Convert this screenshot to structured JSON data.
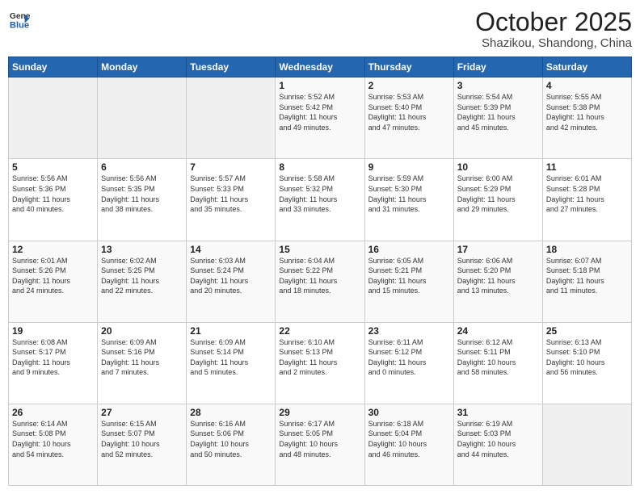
{
  "logo": {
    "general": "General",
    "blue": "Blue"
  },
  "title": "October 2025",
  "location": "Shazikou, Shandong, China",
  "days_header": [
    "Sunday",
    "Monday",
    "Tuesday",
    "Wednesday",
    "Thursday",
    "Friday",
    "Saturday"
  ],
  "weeks": [
    [
      {
        "day": "",
        "info": ""
      },
      {
        "day": "",
        "info": ""
      },
      {
        "day": "",
        "info": ""
      },
      {
        "day": "1",
        "info": "Sunrise: 5:52 AM\nSunset: 5:42 PM\nDaylight: 11 hours\nand 49 minutes."
      },
      {
        "day": "2",
        "info": "Sunrise: 5:53 AM\nSunset: 5:40 PM\nDaylight: 11 hours\nand 47 minutes."
      },
      {
        "day": "3",
        "info": "Sunrise: 5:54 AM\nSunset: 5:39 PM\nDaylight: 11 hours\nand 45 minutes."
      },
      {
        "day": "4",
        "info": "Sunrise: 5:55 AM\nSunset: 5:38 PM\nDaylight: 11 hours\nand 42 minutes."
      }
    ],
    [
      {
        "day": "5",
        "info": "Sunrise: 5:56 AM\nSunset: 5:36 PM\nDaylight: 11 hours\nand 40 minutes."
      },
      {
        "day": "6",
        "info": "Sunrise: 5:56 AM\nSunset: 5:35 PM\nDaylight: 11 hours\nand 38 minutes."
      },
      {
        "day": "7",
        "info": "Sunrise: 5:57 AM\nSunset: 5:33 PM\nDaylight: 11 hours\nand 35 minutes."
      },
      {
        "day": "8",
        "info": "Sunrise: 5:58 AM\nSunset: 5:32 PM\nDaylight: 11 hours\nand 33 minutes."
      },
      {
        "day": "9",
        "info": "Sunrise: 5:59 AM\nSunset: 5:30 PM\nDaylight: 11 hours\nand 31 minutes."
      },
      {
        "day": "10",
        "info": "Sunrise: 6:00 AM\nSunset: 5:29 PM\nDaylight: 11 hours\nand 29 minutes."
      },
      {
        "day": "11",
        "info": "Sunrise: 6:01 AM\nSunset: 5:28 PM\nDaylight: 11 hours\nand 27 minutes."
      }
    ],
    [
      {
        "day": "12",
        "info": "Sunrise: 6:01 AM\nSunset: 5:26 PM\nDaylight: 11 hours\nand 24 minutes."
      },
      {
        "day": "13",
        "info": "Sunrise: 6:02 AM\nSunset: 5:25 PM\nDaylight: 11 hours\nand 22 minutes."
      },
      {
        "day": "14",
        "info": "Sunrise: 6:03 AM\nSunset: 5:24 PM\nDaylight: 11 hours\nand 20 minutes."
      },
      {
        "day": "15",
        "info": "Sunrise: 6:04 AM\nSunset: 5:22 PM\nDaylight: 11 hours\nand 18 minutes."
      },
      {
        "day": "16",
        "info": "Sunrise: 6:05 AM\nSunset: 5:21 PM\nDaylight: 11 hours\nand 15 minutes."
      },
      {
        "day": "17",
        "info": "Sunrise: 6:06 AM\nSunset: 5:20 PM\nDaylight: 11 hours\nand 13 minutes."
      },
      {
        "day": "18",
        "info": "Sunrise: 6:07 AM\nSunset: 5:18 PM\nDaylight: 11 hours\nand 11 minutes."
      }
    ],
    [
      {
        "day": "19",
        "info": "Sunrise: 6:08 AM\nSunset: 5:17 PM\nDaylight: 11 hours\nand 9 minutes."
      },
      {
        "day": "20",
        "info": "Sunrise: 6:09 AM\nSunset: 5:16 PM\nDaylight: 11 hours\nand 7 minutes."
      },
      {
        "day": "21",
        "info": "Sunrise: 6:09 AM\nSunset: 5:14 PM\nDaylight: 11 hours\nand 5 minutes."
      },
      {
        "day": "22",
        "info": "Sunrise: 6:10 AM\nSunset: 5:13 PM\nDaylight: 11 hours\nand 2 minutes."
      },
      {
        "day": "23",
        "info": "Sunrise: 6:11 AM\nSunset: 5:12 PM\nDaylight: 11 hours\nand 0 minutes."
      },
      {
        "day": "24",
        "info": "Sunrise: 6:12 AM\nSunset: 5:11 PM\nDaylight: 10 hours\nand 58 minutes."
      },
      {
        "day": "25",
        "info": "Sunrise: 6:13 AM\nSunset: 5:10 PM\nDaylight: 10 hours\nand 56 minutes."
      }
    ],
    [
      {
        "day": "26",
        "info": "Sunrise: 6:14 AM\nSunset: 5:08 PM\nDaylight: 10 hours\nand 54 minutes."
      },
      {
        "day": "27",
        "info": "Sunrise: 6:15 AM\nSunset: 5:07 PM\nDaylight: 10 hours\nand 52 minutes."
      },
      {
        "day": "28",
        "info": "Sunrise: 6:16 AM\nSunset: 5:06 PM\nDaylight: 10 hours\nand 50 minutes."
      },
      {
        "day": "29",
        "info": "Sunrise: 6:17 AM\nSunset: 5:05 PM\nDaylight: 10 hours\nand 48 minutes."
      },
      {
        "day": "30",
        "info": "Sunrise: 6:18 AM\nSunset: 5:04 PM\nDaylight: 10 hours\nand 46 minutes."
      },
      {
        "day": "31",
        "info": "Sunrise: 6:19 AM\nSunset: 5:03 PM\nDaylight: 10 hours\nand 44 minutes."
      },
      {
        "day": "",
        "info": ""
      }
    ]
  ]
}
